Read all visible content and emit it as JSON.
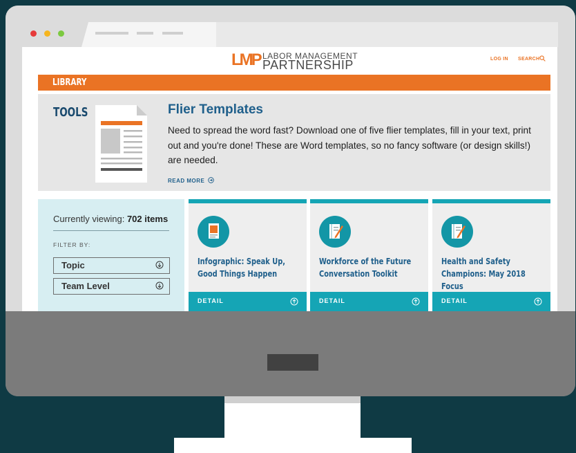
{
  "nav": {
    "logo_mark": "LMP",
    "logo_line1": "LABOR MANAGEMENT",
    "logo_line2": "PARTNERSHIP",
    "login": "LOG IN",
    "search": "SEARCH"
  },
  "library_bar": "LIBRARY",
  "feature": {
    "section": "TOOLS",
    "title": "Flier Templates",
    "body": "Need to spread the word fast? Download one of five flier templates, fill in your text, print out and you're done! These are Word templates, so no fancy software (or design skills!) are needed.",
    "read_more": "READ MORE"
  },
  "sidebar": {
    "viewing_prefix": "Currently viewing: ",
    "viewing_count": "702 items",
    "filter_by": "FILTER BY:",
    "filters": [
      "Topic",
      "Team Level"
    ]
  },
  "cards": [
    {
      "title": "Infographic: Speak Up, Good Things Happen",
      "detail": "DETAIL",
      "icon": "infographic-icon"
    },
    {
      "title": "Workforce of the Future Conversation Toolkit",
      "detail": "DETAIL",
      "icon": "notepad-icon"
    },
    {
      "title": "Health and Safety Champions: May 2018 Focus",
      "detail": "DETAIL",
      "icon": "notepad-icon"
    }
  ],
  "colors": {
    "accent_orange": "#ea7324",
    "teal": "#15a5b5",
    "navy": "#1f5f8b",
    "background": "#0f3a44"
  }
}
